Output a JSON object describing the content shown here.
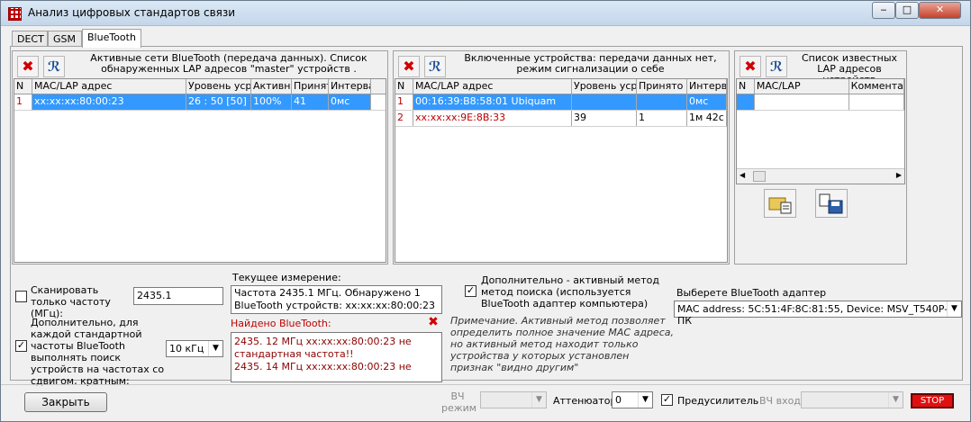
{
  "window": {
    "title": "Анализ цифровых стандартов связи",
    "minimize": "‒",
    "maximize": "□",
    "close": "✕"
  },
  "tabs": [
    "DECT",
    "GSM",
    "BlueTooth"
  ],
  "panel1": {
    "caption": "Активные сети BlueTooth (передача данных). Список обнаруженных LAP адресов \"master\" устройств .",
    "columns": [
      "N",
      "MAC/LAP адрес",
      "Уровень усре",
      "Активно",
      "Принят",
      "Интерва"
    ],
    "rows": [
      [
        "1",
        "xx:xx:xx:80:00:23",
        "26 : 50    [50]",
        "100%",
        "41",
        "0мс"
      ]
    ]
  },
  "panel2": {
    "caption": "Включенные устройства: передачи данных нет, режим сигнализации о себе",
    "columns": [
      "N",
      "MAC/LAP адрес",
      "Уровень усре",
      "Принято п",
      "Интерв"
    ],
    "rows": [
      [
        "1",
        "00:16:39:B8:58:01 Ubiquam",
        "",
        "",
        "0мс"
      ],
      [
        "2",
        "xx:xx:xx:9E:8B:33",
        "39",
        "1",
        "1м 42с"
      ]
    ]
  },
  "panel3": {
    "caption": "Список известных LAP адресов устройств",
    "columns": [
      "N",
      "MAC/LAP",
      "Комментар"
    ]
  },
  "scan": {
    "label": "Сканировать только частоту (МГц):",
    "value": "2435.1"
  },
  "extra": {
    "label": "Дополнительно, для каждой стандартной частоты BlueTooth выполнять поиск устройств на частотах со сдвигом, кратным:",
    "value": "10 кГц"
  },
  "current": {
    "label": "Текущее измерение:",
    "text": "Частота 2435.1 МГц. Обнаружено 1 BlueTooth устройств: xx:xx:xx:80:00:23"
  },
  "found": {
    "label": "Найдено BlueTooth:",
    "lines": [
      "2435. 12 МГц xx:xx:xx:80:00:23 не стандартная частота!!",
      "2435. 14 МГц xx:xx:xx:80:00:23 не"
    ]
  },
  "active": {
    "label": "Дополнительно - активный метод метод поиска (используется BlueTooth адаптер компьютера)"
  },
  "note": "Примечание. Активный метод позволяет определить полное значение МАС адреса, но активный метод находит только устройства у которых установлен признак \"видно другим\"",
  "adapter": {
    "label": "Выберете BlueTooth адаптер",
    "value": "MAC address: 5C:51:4F:8C:81:55, Device: MSV_T540P-ПК"
  },
  "bottom": {
    "close": "Закрыть",
    "vch_mode": "ВЧ режим",
    "attenuator": "Аттенюатор",
    "attenuator_value": "0",
    "preamp": "Предусилитель",
    "vch_input": "ВЧ вход",
    "stop": "STOP"
  }
}
